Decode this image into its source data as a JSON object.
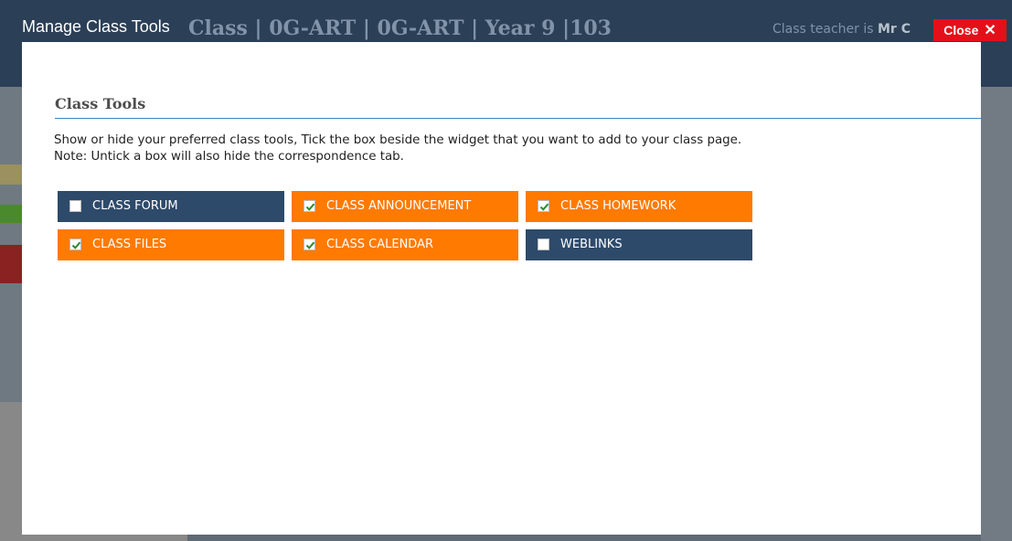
{
  "background": {
    "title": "Class  | 0G-ART | 0G-ART | Year 9 |103",
    "teacher_prefix": "Class teacher is",
    "teacher_name": "Mr C"
  },
  "modal": {
    "title": "Manage Class Tools",
    "close_label": "Close",
    "close_icon": "✕",
    "section_title": "Class Tools",
    "description_line1": "Show or hide your preferred class tools, Tick the box beside the widget that you want to add to your class page.",
    "description_line2": "Note: Untick a box will also hide the correspondence tab."
  },
  "tools": [
    {
      "label": "CLASS FORUM",
      "checked": false
    },
    {
      "label": "CLASS ANNOUNCEMENT",
      "checked": true
    },
    {
      "label": "CLASS HOMEWORK",
      "checked": true
    },
    {
      "label": "CLASS FILES",
      "checked": true
    },
    {
      "label": "CLASS CALENDAR",
      "checked": true
    },
    {
      "label": "WEBLINKS",
      "checked": false
    }
  ],
  "colors": {
    "checked": "#ff7a00",
    "unchecked": "#2d4a6b",
    "close": "#e3101a",
    "accent_line": "#3a87c8"
  }
}
